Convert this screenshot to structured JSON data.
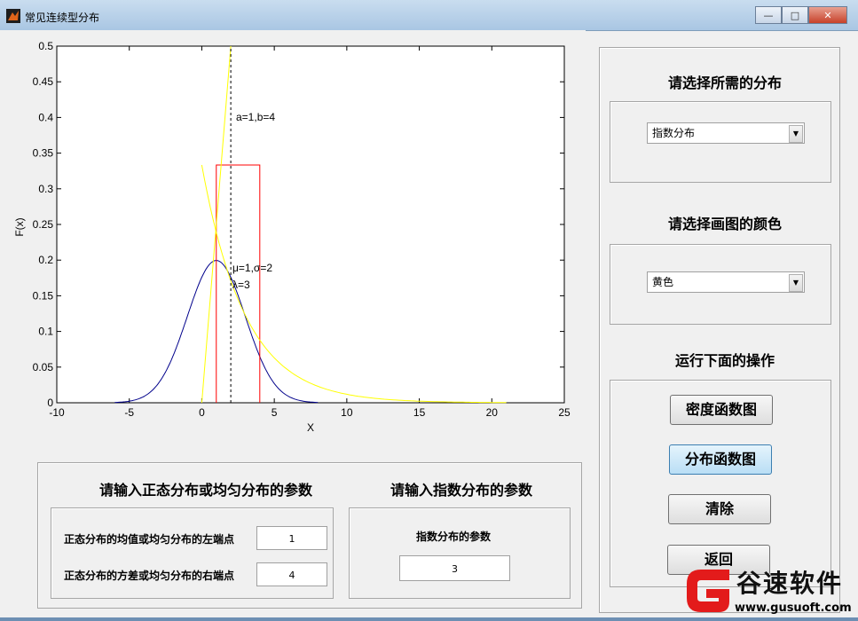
{
  "window": {
    "title": "常见连续型分布",
    "minimize": "—",
    "maximize": "□",
    "close": "✕"
  },
  "plot": {
    "ylabel": "F(x)",
    "xlabel": "X",
    "xticks": [
      "-10",
      "-5",
      "0",
      "5",
      "10",
      "15",
      "20",
      "25"
    ],
    "yticks": [
      "0",
      "0.05",
      "0.1",
      "0.15",
      "0.2",
      "0.25",
      "0.3",
      "0.35",
      "0.4",
      "0.45",
      "0.5"
    ],
    "annotations": {
      "uniform": "a=1,b=4",
      "normal": "μ=1,σ=2",
      "exponential": "λ=3"
    }
  },
  "right_panel": {
    "dist_title": "请选择所需的分布",
    "dist_selected": "指数分布",
    "color_title": "请选择画图的颜色",
    "color_selected": "黄色",
    "ops_title": "运行下面的操作",
    "buttons": {
      "density": "密度函数图",
      "cdf": "分布函数图",
      "clear": "清除",
      "back": "返回"
    }
  },
  "bottom_left": {
    "title": "请输入正态分布或均匀分布的参数",
    "param1_label": "正态分布的均值或均匀分布的左端点",
    "param1_value": "1",
    "param2_label": "正态分布的方差或均匀分布的右端点",
    "param2_value": "4"
  },
  "bottom_right": {
    "title": "请输入指数分布的参数",
    "label": "指数分布的参数",
    "value": "3"
  },
  "watermark": {
    "text": "谷速软件",
    "url": "www.gusuoft.com"
  },
  "chart_data": {
    "type": "line",
    "xlim": [
      -10,
      25
    ],
    "ylim": [
      0,
      0.5
    ],
    "xlabel": "X",
    "ylabel": "F(x)",
    "series": [
      {
        "name": "normal",
        "color": "#00008b",
        "params": {
          "mu": 1,
          "sigma": 2
        }
      },
      {
        "name": "uniform",
        "color": "#ff0000",
        "params": {
          "a": 1,
          "b": 4
        }
      },
      {
        "name": "exponential",
        "color": "#ffff00",
        "params": {
          "lambda": 3
        }
      },
      {
        "name": "uniform-line",
        "color": "#000000",
        "params": {
          "x": 2
        }
      }
    ]
  }
}
